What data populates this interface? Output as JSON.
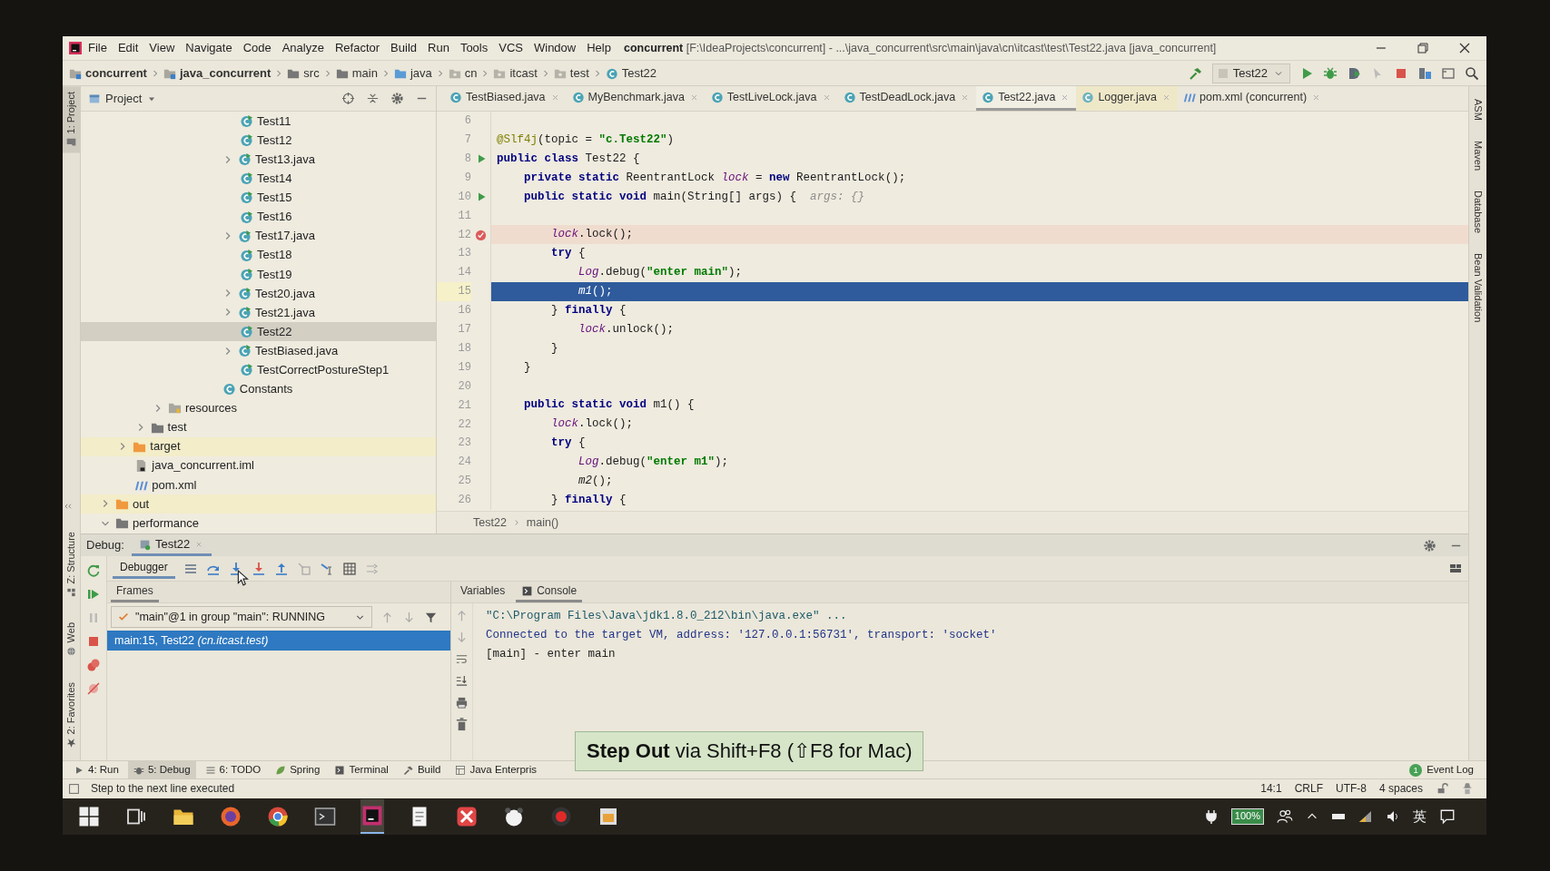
{
  "window": {
    "title": "**concurrent** [F:\\IdeaProjects\\concurrent] - ...\\java_concurrent\\src\\main\\java\\cn\\itcast\\test\\Test22.java [java_concurrent]"
  },
  "menu": [
    "File",
    "Edit",
    "View",
    "Navigate",
    "Code",
    "Analyze",
    "Refactor",
    "Build",
    "Run",
    "Tools",
    "VCS",
    "Window",
    "Help"
  ],
  "breadcrumb": [
    {
      "label": "concurrent",
      "kind": "module"
    },
    {
      "label": "java_concurrent",
      "kind": "module"
    },
    {
      "label": "src",
      "kind": "folder"
    },
    {
      "label": "main",
      "kind": "folder"
    },
    {
      "label": "java",
      "kind": "source"
    },
    {
      "label": "cn",
      "kind": "package"
    },
    {
      "label": "itcast",
      "kind": "package"
    },
    {
      "label": "test",
      "kind": "package"
    },
    {
      "label": "Test22",
      "kind": "class"
    }
  ],
  "run_config": {
    "label": "Test22"
  },
  "left_stripe_top": [
    {
      "label": "1: Project",
      "kind": "project",
      "selected": true
    }
  ],
  "left_stripe_bottom": [
    {
      "label": "Z: Structure",
      "kind": "structure",
      "selected": false
    },
    {
      "label": "Web",
      "kind": "web",
      "selected": false
    },
    {
      "label": "2: Favorites",
      "kind": "favorites",
      "selected": false
    }
  ],
  "right_stripe": [
    "ASM",
    "Maven",
    "Database",
    "Bean Validation"
  ],
  "project_panel": {
    "title": "Project"
  },
  "project_tree": [
    {
      "children": [
        {
          "children": [
            {
              "children": [
                {
                  "children": [
                    {
                      "children": [
                        {
                          "children": [
                            {
                              "children": [
                                {
                                  "label": "Test11",
                                  "kind": "runnable-class",
                                  "selected": false
                                },
                                {
                                  "label": "Test12",
                                  "kind": "runnable-class",
                                  "selected": false
                                },
                                {
                                  "label": "Test13.java",
                                  "kind": "runnable-class",
                                  "expanded": false,
                                  "selected": false
                                },
                                {
                                  "label": "Test14",
                                  "kind": "runnable-class",
                                  "selected": false
                                },
                                {
                                  "label": "Test15",
                                  "kind": "runnable-class",
                                  "selected": false
                                },
                                {
                                  "label": "Test16",
                                  "kind": "runnable-class",
                                  "selected": false
                                },
                                {
                                  "label": "Test17.java",
                                  "kind": "runnable-class",
                                  "expanded": false,
                                  "selected": false
                                },
                                {
                                  "label": "Test18",
                                  "kind": "runnable-class",
                                  "selected": false
                                },
                                {
                                  "label": "Test19",
                                  "kind": "runnable-class",
                                  "selected": false
                                },
                                {
                                  "label": "Test20.java",
                                  "kind": "runnable-class",
                                  "expanded": false,
                                  "selected": false
                                },
                                {
                                  "label": "Test21.java",
                                  "kind": "runnable-class",
                                  "expanded": false,
                                  "selected": false
                                },
                                {
                                  "label": "Test22",
                                  "kind": "runnable-class",
                                  "selected": true
                                },
                                {
                                  "label": "TestBiased.java",
                                  "kind": "runnable-class",
                                  "expanded": false,
                                  "selected": false
                                },
                                {
                                  "label": "TestCorrectPostureStep1",
                                  "kind": "runnable-class",
                                  "selected": false
                                }
                              ]
                            },
                            {
                              "label": "Constants",
                              "kind": "class",
                              "selected": false
                            }
                          ]
                        }
                      ]
                    }
                  ]
                },
                {
                  "label": "resources",
                  "kind": "resource-folder",
                  "expanded": false,
                  "selected": false
                }
              ]
            },
            {
              "label": "test",
              "kind": "folder",
              "expanded": false,
              "selected": false
            }
          ]
        },
        {
          "label": "target",
          "kind": "excluded-folder",
          "expanded": false,
          "selected": false
        },
        {
          "label": "java_concurrent.iml",
          "kind": "module-file",
          "selected": false
        },
        {
          "label": "pom.xml",
          "kind": "pom",
          "selected": false
        }
      ]
    },
    {
      "label": "out",
      "kind": "excluded-folder",
      "expanded": false,
      "selected": false
    },
    {
      "label": "performance",
      "kind": "folder",
      "expanded": true,
      "selected": false
    }
  ],
  "editor_tabs": [
    {
      "label": "TestBiased.java",
      "kind": "class",
      "selected": false
    },
    {
      "label": "MyBenchmark.java",
      "kind": "class",
      "selected": false
    },
    {
      "label": "TestLiveLock.java",
      "kind": "class",
      "selected": false
    },
    {
      "label": "TestDeadLock.java",
      "kind": "class",
      "selected": false
    },
    {
      "label": "Test22.java",
      "kind": "class",
      "selected": true
    },
    {
      "label": "Logger.java",
      "kind": "library-class",
      "selected": false
    },
    {
      "label": "pom.xml (concurrent)",
      "kind": "pom",
      "selected": false
    }
  ],
  "code": {
    "lines": [
      {
        "number": "6",
        "kind": "plain",
        "run_marker": false
      },
      {
        "number": "7",
        "kind": "plain",
        "run_marker": false,
        "tokens": [
          {
            "text": "@Slf4j",
            "kind": "ann"
          },
          {
            "text": "(topic = "
          },
          {
            "text": "\"c.Test22\"",
            "kind": "str"
          },
          {
            "text": ")"
          }
        ]
      },
      {
        "number": "8",
        "kind": "plain",
        "run_marker": true,
        "tokens": [
          {
            "text": "public class ",
            "kind": "kw"
          },
          {
            "text": "Test22 {"
          }
        ]
      },
      {
        "number": "9",
        "kind": "plain",
        "run_marker": false,
        "tokens": [
          {
            "text": "    private static ",
            "kind": "kw"
          },
          {
            "text": "ReentrantLock "
          },
          {
            "text": "lock",
            "kind": "field"
          },
          {
            "text": " = "
          },
          {
            "text": "new ",
            "kind": "kw"
          },
          {
            "text": "ReentrantLock();"
          }
        ]
      },
      {
        "number": "10",
        "kind": "plain",
        "run_marker": true,
        "tokens": [
          {
            "text": "    public static void ",
            "kind": "kw"
          },
          {
            "text": "main(String[] args) {  "
          },
          {
            "text": "args: {}",
            "kind": "hint"
          }
        ]
      },
      {
        "number": "11",
        "kind": "plain",
        "run_marker": false
      },
      {
        "number": "12",
        "kind": "breakpoint",
        "run_marker": false,
        "tokens": [
          {
            "text": "        lock",
            "kind": "field"
          },
          {
            "text": ".lock();"
          }
        ]
      },
      {
        "number": "13",
        "kind": "plain",
        "run_marker": false,
        "tokens": [
          {
            "text": "        try ",
            "kind": "kw"
          },
          {
            "text": "{"
          }
        ]
      },
      {
        "number": "14",
        "kind": "plain",
        "run_marker": false,
        "tokens": [
          {
            "text": "            Log",
            "kind": "field"
          },
          {
            "text": ".debug("
          },
          {
            "text": "\"enter main\"",
            "kind": "str"
          },
          {
            "text": ");"
          }
        ]
      },
      {
        "number": "15",
        "kind": "execution",
        "run_marker": false,
        "tokens": [
          {
            "text": "            m1",
            "kind": "call"
          },
          {
            "text": "();"
          }
        ]
      },
      {
        "number": "16",
        "kind": "plain",
        "run_marker": false,
        "tokens": [
          {
            "text": "        } "
          },
          {
            "text": "finally ",
            "kind": "kw"
          },
          {
            "text": "{"
          }
        ]
      },
      {
        "number": "17",
        "kind": "plain",
        "run_marker": false,
        "tokens": [
          {
            "text": "            lock",
            "kind": "field"
          },
          {
            "text": ".unlock();"
          }
        ]
      },
      {
        "number": "18",
        "kind": "plain",
        "run_marker": false,
        "tokens": [
          {
            "text": "        }"
          }
        ]
      },
      {
        "number": "19",
        "kind": "plain",
        "run_marker": false,
        "tokens": [
          {
            "text": "    }"
          }
        ]
      },
      {
        "number": "20",
        "kind": "plain",
        "run_marker": false
      },
      {
        "number": "21",
        "kind": "plain",
        "run_marker": false,
        "tokens": [
          {
            "text": "    public static void ",
            "kind": "kw"
          },
          {
            "text": "m1() {"
          }
        ]
      },
      {
        "number": "22",
        "kind": "plain",
        "run_marker": false,
        "tokens": [
          {
            "text": "        lock",
            "kind": "field"
          },
          {
            "text": ".lock();"
          }
        ]
      },
      {
        "number": "23",
        "kind": "plain",
        "run_marker": false,
        "tokens": [
          {
            "text": "        try ",
            "kind": "kw"
          },
          {
            "text": "{"
          }
        ]
      },
      {
        "number": "24",
        "kind": "plain",
        "run_marker": false,
        "tokens": [
          {
            "text": "            Log",
            "kind": "field"
          },
          {
            "text": ".debug("
          },
          {
            "text": "\"enter m1\"",
            "kind": "str"
          },
          {
            "text": ");"
          }
        ]
      },
      {
        "number": "25",
        "kind": "plain",
        "run_marker": false,
        "tokens": [
          {
            "text": "            m2",
            "kind": "call"
          },
          {
            "text": "();"
          }
        ]
      },
      {
        "number": "26",
        "kind": "plain",
        "run_marker": false,
        "tokens": [
          {
            "text": "        } "
          },
          {
            "text": "finally ",
            "kind": "kw"
          },
          {
            "text": "{"
          }
        ]
      }
    ],
    "breadcrumb": [
      "Test22",
      "main()"
    ]
  },
  "debug": {
    "label": "Debug:",
    "session_tab": {
      "label": "Test22",
      "selected": true
    },
    "tabs": [
      {
        "label": "Debugger",
        "selected": true
      }
    ],
    "frames_label": "Frames",
    "thread": {
      "label": "\"main\"@1 in group \"main\": RUNNING"
    },
    "frames": [
      {
        "label": "main:15, Test22 *(cn.itcast.test)*",
        "selected": true
      }
    ],
    "console_tabs": [
      {
        "label": "Variables",
        "kind": "variables",
        "selected": false
      },
      {
        "label": "Console",
        "kind": "console",
        "selected": true
      }
    ],
    "console": [
      {
        "text": "\"C:\\Program Files\\Java\\jdk1.8.0_212\\bin\\java.exe\" ...",
        "kind": "command"
      },
      {
        "text": "Connected to the target VM, address: '127.0.0.1:56731', transport: 'socket'",
        "kind": "system"
      },
      {
        "text": "[main] - enter main",
        "kind": "output"
      }
    ]
  },
  "tooltip": "**Step Out** via Shift+F8 (⇧F8 for Mac)",
  "tool_buttons": [
    {
      "label": "4: Run",
      "kind": "run",
      "selected": false
    },
    {
      "label": "5: Debug",
      "kind": "debug",
      "selected": true
    },
    {
      "label": "6: TODO",
      "kind": "todo",
      "selected": false
    },
    {
      "label": "Spring",
      "kind": "spring",
      "selected": false
    },
    {
      "label": "Terminal",
      "kind": "terminal",
      "selected": false
    },
    {
      "label": "Build",
      "kind": "build",
      "selected": false
    },
    {
      "label": "Java Enterpris",
      "kind": "javaee",
      "selected": false
    }
  ],
  "event_log": {
    "label": "Event Log",
    "count": "1"
  },
  "status": {
    "message": "Step to the next line executed",
    "items": [
      "14:1",
      "CRLF",
      "UTF-8",
      "4 spaces"
    ]
  },
  "taskbar": {
    "apps": [
      {
        "kind": "start",
        "selected": false
      },
      {
        "kind": "task-view",
        "selected": false
      },
      {
        "kind": "files",
        "selected": false
      },
      {
        "kind": "fox",
        "selected": false
      },
      {
        "kind": "chrome",
        "selected": false
      },
      {
        "kind": "terminal",
        "selected": false
      },
      {
        "kind": "ide",
        "selected": true
      },
      {
        "kind": "notes",
        "selected": false
      },
      {
        "kind": "xapp",
        "selected": false
      },
      {
        "kind": "panda",
        "selected": false
      },
      {
        "kind": "record",
        "selected": false
      },
      {
        "kind": "pkg",
        "selected": false
      }
    ],
    "battery": "100%",
    "ime": "英"
  }
}
